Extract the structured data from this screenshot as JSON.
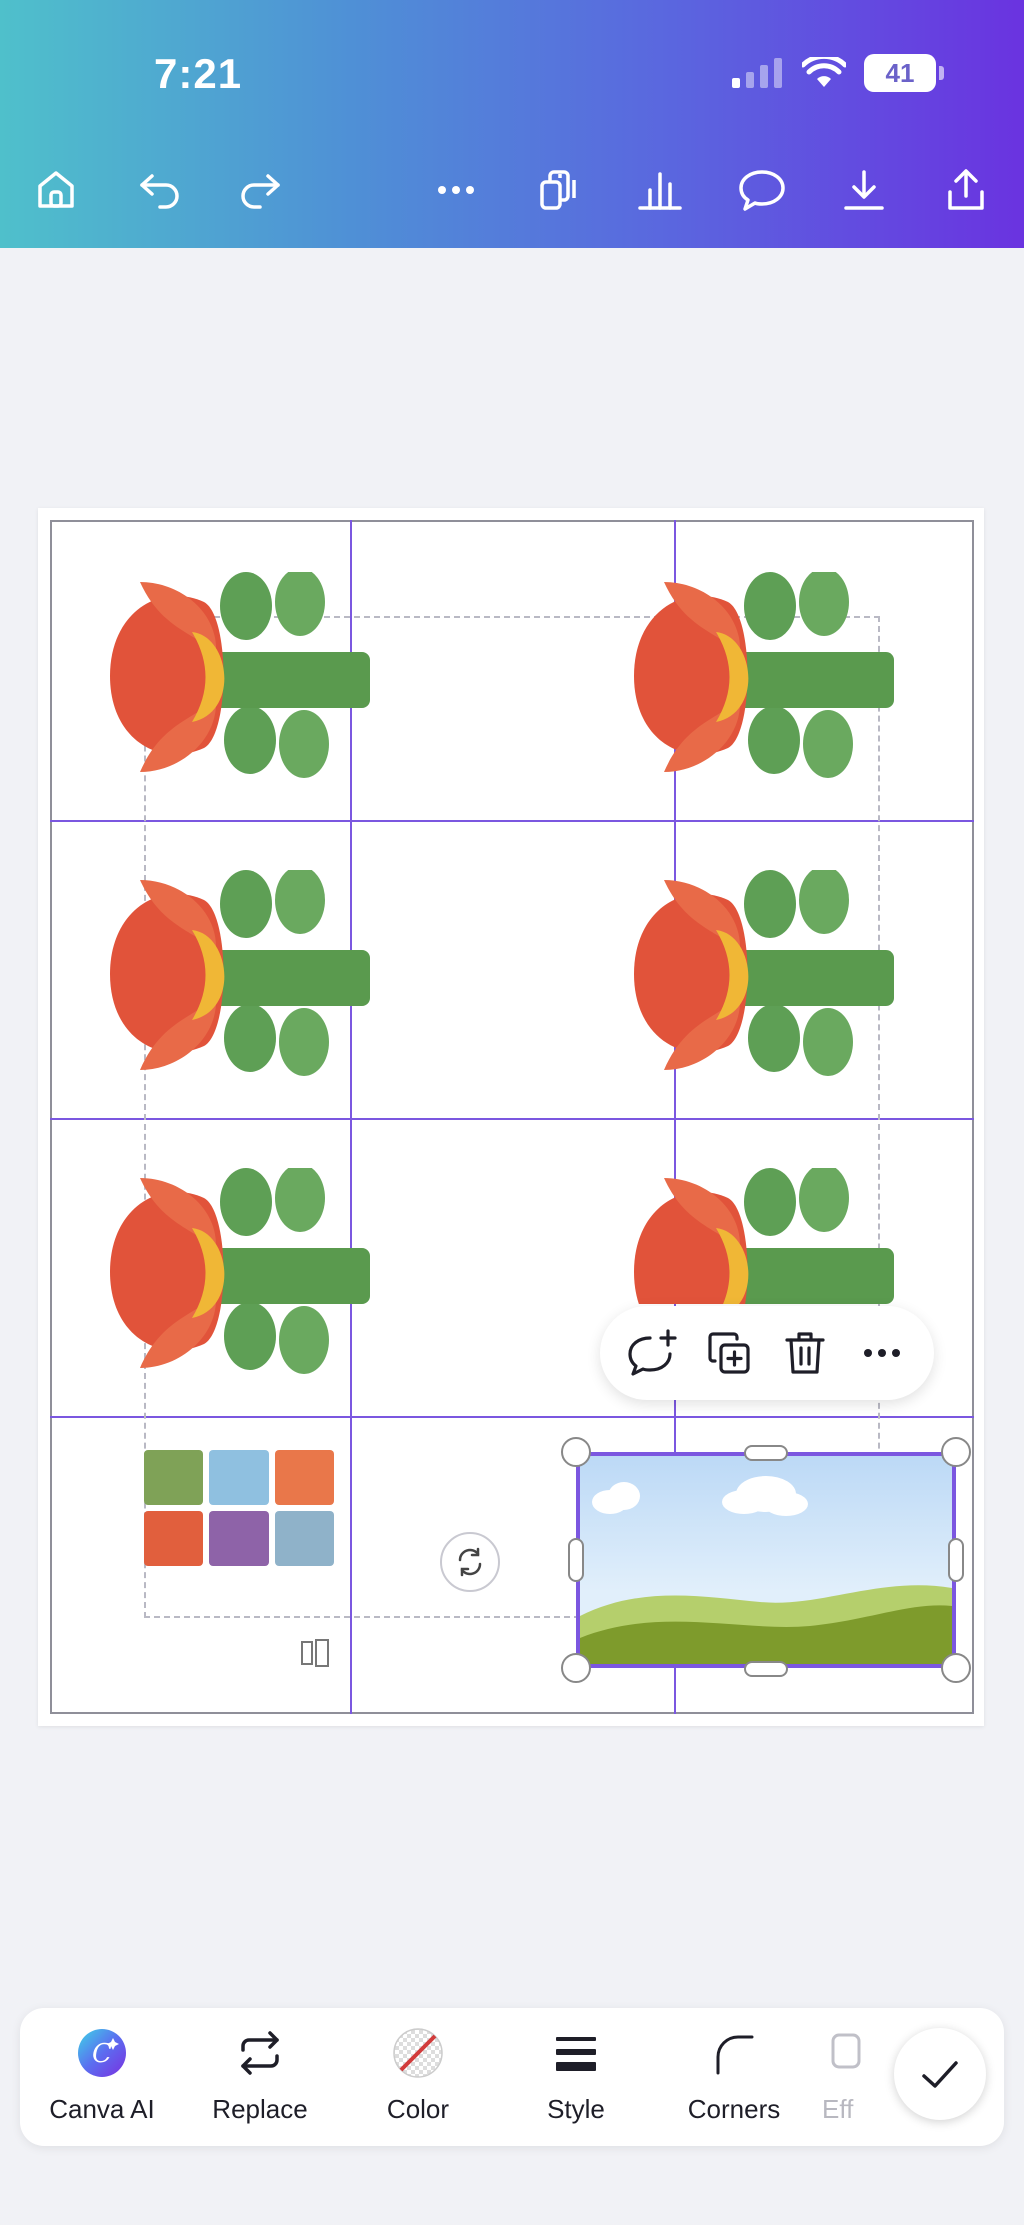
{
  "status_bar": {
    "time": "7:21",
    "battery": "41"
  },
  "header_toolbar": {
    "icons": [
      "home-icon",
      "undo-icon",
      "redo-icon",
      "more-icon",
      "pages-icon",
      "insights-icon",
      "comment-icon",
      "download-icon",
      "share-icon"
    ]
  },
  "canvas": {
    "grid_rows": 4,
    "grid_cols": 2,
    "selected_element": "landscape-placeholder-image"
  },
  "context_menu": {
    "actions": [
      "add-comment",
      "duplicate",
      "delete",
      "more"
    ]
  },
  "bottom_toolbar": {
    "tools": [
      {
        "label": "Canva AI"
      },
      {
        "label": "Replace"
      },
      {
        "label": "Color"
      },
      {
        "label": "Style"
      },
      {
        "label": "Corners"
      },
      {
        "label": "Eff"
      }
    ]
  },
  "colors": {
    "accent": "#7b57e0",
    "header_start": "#4fc0cb",
    "header_end": "#6a33e0"
  }
}
